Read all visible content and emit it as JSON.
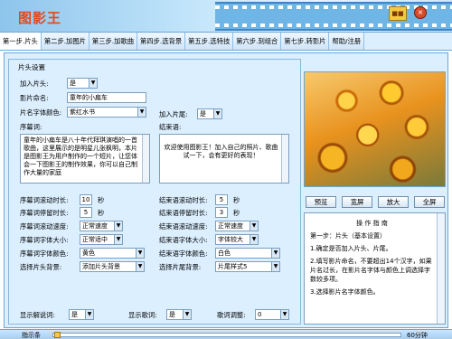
{
  "app": {
    "title": "图影王",
    "min_label": "■■",
    "close_label": "×"
  },
  "tabs": [
    "第一步.片头",
    "第二步.加图片",
    "第三步.加歌曲",
    "第四步.选背景",
    "第五步.选特技",
    "第六步.刻组合",
    "第七步.转影片",
    "帮助/注册"
  ],
  "section_title": "片头设置",
  "form": {
    "add_head_label": "加入片头:",
    "add_head_value": "是",
    "title_name_label": "影片命名:",
    "title_name_value": "童年的小扁车",
    "font_color_label": "片名字体颜色:",
    "font_color_value": "紫红水书",
    "add_tail_label": "加入片尾:",
    "add_tail_value": "是",
    "intro_label": "序幕词:",
    "intro_text": "童年的小扁车是八十年代拜琪演唱的一首歌曲，这里展示的是明星儿张枫明，本片是图影王为用户制作的一个短片，让您体会一下图影王的制作效果，你可以自己制作大量的家庭",
    "ending_label": "结束语:",
    "ending_text": "欢迎使用图影王！加入自己的照片、歌曲试一下，会有更好的表现！",
    "intro_scroll_time_label": "序幕词滚动时长:",
    "intro_scroll_time_value": "10",
    "unit_sec": "秒",
    "intro_stay_time_label": "序幕词停留时长:",
    "intro_stay_time_value": "5",
    "intro_scroll_speed_label": "序幕词滚动速度:",
    "intro_scroll_speed_value": "正常速度",
    "intro_font_size_label": "序幕词字体大小:",
    "intro_font_size_value": "正常适中",
    "intro_font_color_label": "序幕词字体颜色:",
    "intro_font_color_value": "黄色",
    "head_bg_label": "选择片头背景:",
    "head_bg_value": "添加片头背景",
    "end_scroll_time_label": "结束语滚动时长:",
    "end_scroll_time_value": "5",
    "end_stay_time_label": "结束语停留时长:",
    "end_stay_time_value": "3",
    "end_scroll_speed_label": "结束语滚动速度:",
    "end_scroll_speed_value": "正常速度",
    "end_font_size_label": "结束语字体大小:",
    "end_font_size_value": "字体较大",
    "end_font_color_label": "结束语字体颜色:",
    "end_font_color_value": "白色",
    "tail_bg_label": "选择片尾背景:",
    "tail_bg_value": "片尾样式5",
    "show_narration_label": "显示解说词:",
    "show_narration_value": "是",
    "show_lyrics_label": "显示歌词:",
    "show_lyrics_value": "是",
    "lyric_adjust_label": "歌词调整:",
    "lyric_adjust_value": "0"
  },
  "preview_buttons": [
    "预览",
    "宽屏",
    "放大",
    "全屏"
  ],
  "guide": {
    "title": "操 作 指 南",
    "lines": [
      "第一步：片头（基本设置）",
      "1.确定是否加入片头、片尾。",
      "2.填写影片命名，不要超出14个汉字，如果片名过长，在影片名字体与颜色上调选择字数较多项。",
      "3.选择影片名字体颜色。"
    ]
  },
  "bottom": {
    "label": "指示条",
    "end_label": "60分钟",
    "progress": 0
  }
}
